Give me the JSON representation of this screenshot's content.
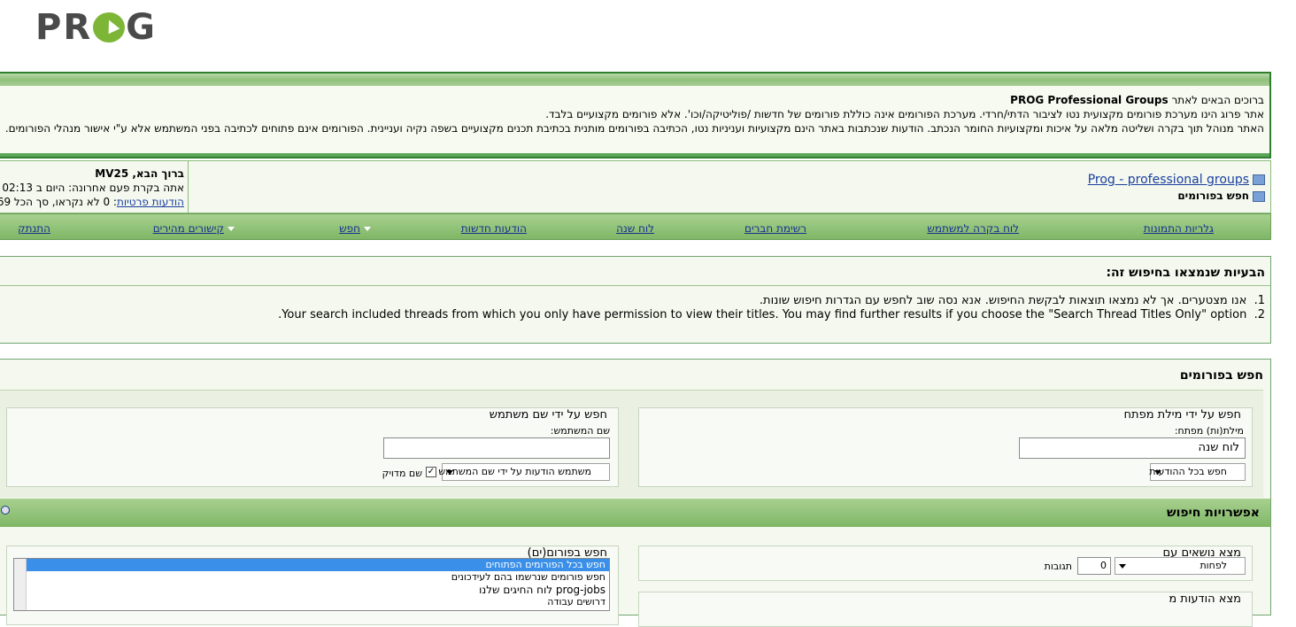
{
  "logo": {
    "text_left": "PR",
    "text_right": "G"
  },
  "welcome": {
    "line1_prefix": "ברוכים הבאים לאתר ",
    "line1_brand": "PROG Professional Groups",
    "line2": "אתר פרוג הינו מערכת פורומים מקצועית נטו לציבור הדתי/חרדי. מערכת הפורומים אינה כוללת פורומים של חדשות /פוליטיקה/וכו'. אלא פורומים מקצועיים בלבד.",
    "line3": "האתר מנוהל תוך בקרה ושליטה מלאה על איכות ומקצועיות החומר הנכתב. הודעות שנכתבות באתר הינם מקצועיות ועניניות נטו, הכתיבה בפורומים מותנית בכתיבת תכנים מקצועיים בשפה נקיה ועניינית. הפורומים אינם פתוחים לכתיבה בפני המשתמש אלא ע\"י אישור מנהלי הפורומים."
  },
  "breadcrumb": {
    "home": "Prog - professional groups",
    "current": "חפש בפורומים"
  },
  "user": {
    "greeting_prefix": "ברוך הבא, ",
    "username": "MV25",
    "last_visit": "אתה בקרת פעם אחרונה: היום ב 02:13",
    "pm_link": "הודעות פרטיות",
    "pm_info": ": 0 לא נקראו, סך הכל 69"
  },
  "nav": {
    "items": [
      "גלריות התמונות",
      "לוח בקרה למשתמש",
      "רשימת חברים",
      "לוח שנה",
      "הודעות חדשות",
      "חפש",
      "קישורים מהירים",
      "התנתק"
    ]
  },
  "errors": {
    "title": "הבעיות שנמצאו בחיפוש זה:",
    "items": [
      {
        "num": "1.",
        "text": "אנו מצטערים. אך לא נמצאו תוצאות לבקשת החיפוש. אנא נסה שוב לחפש עם הגדרות חיפוש שונות."
      },
      {
        "num": "2.",
        "text": "Your search included threads from which you only have permission to view their titles. You may find further results if you choose the \"Search Thread Titles Only\" option."
      }
    ]
  },
  "search": {
    "title": "חפש בפורומים",
    "keyword": {
      "legend": "חפש על ידי מילת מפתח",
      "label": "מילת(ות) מפתח:",
      "value": "לוח שנה",
      "select": "חפש בכל ההודעות"
    },
    "user": {
      "legend": "חפש על ידי שם משתמש",
      "label": "שם המשתמש:",
      "value": "",
      "select": "משתמש הודעות על ידי שם המשתמש",
      "exact": "שם מדויק"
    }
  },
  "options": {
    "title": "אפשרויות חיפוש",
    "threads": {
      "legend": "מצא נושאים עם",
      "select": "לפחות",
      "count": "0",
      "unit": "תגובות"
    },
    "posts": {
      "legend": "מצא הודעות מ"
    },
    "forums": {
      "legend": "חפש בפורום(ים)",
      "items": [
        "חפש בכל הפורומים הפתוחים",
        "חפש פורומים שנרשמו בהם לעידכונים",
        "prog-jobs לוח החיגים שלנו",
        "דרושים עבודה"
      ]
    }
  }
}
